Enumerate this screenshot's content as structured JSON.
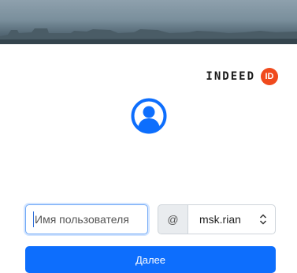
{
  "banner": {
    "caption": "sign-in background image"
  },
  "brand": {
    "logo_text": "INDEED",
    "badge_text": "ID",
    "badge_color": "#f04a1d"
  },
  "avatar": {
    "icon": "user-circle-icon",
    "color": "#0d6efd"
  },
  "login": {
    "username_placeholder": "Имя пользователя",
    "at_symbol": "@",
    "domain_selected": "msk.rian",
    "submit_label": "Далее"
  },
  "colors": {
    "accent": "#0d6efd",
    "focus_border": "#6fa8f6"
  }
}
